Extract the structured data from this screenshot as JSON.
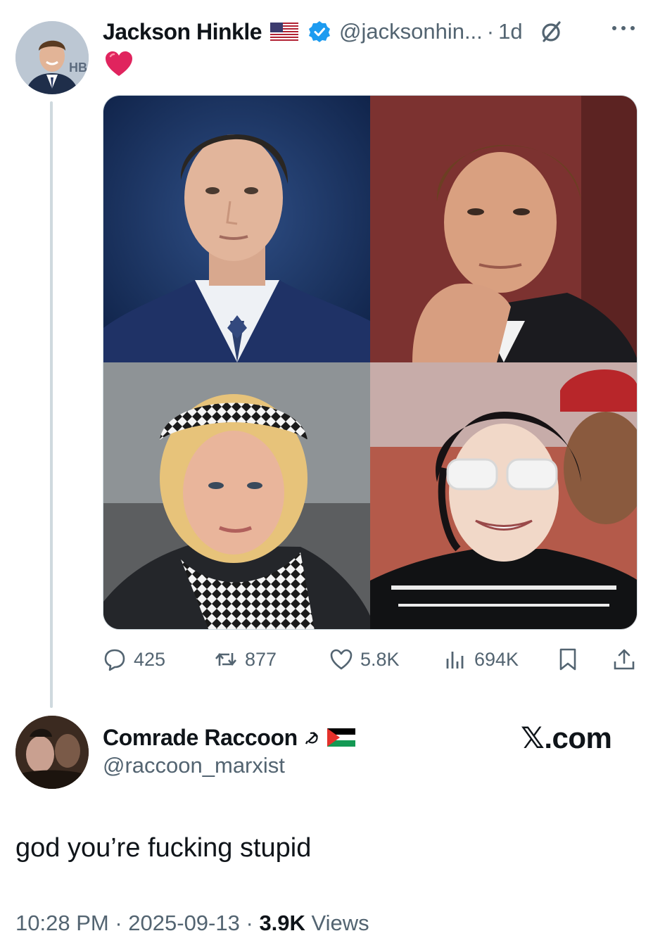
{
  "tweet": {
    "author_name": "Jackson Hinkle",
    "author_handle": "@jacksonhin...",
    "separator": "·",
    "time_ago": "1d",
    "body_emoji": "red-heart",
    "avatar_text": "HB",
    "icons": {
      "flag": "us-flag-icon",
      "verified": "verified-badge-icon",
      "grok": "grok-icon",
      "more": "more-icon"
    },
    "media_grid": [
      "photo-man-blue-suit",
      "photo-man-dark-suit",
      "photo-woman-keffiyeh-headband",
      "photo-man-sunglasses-uniform"
    ],
    "stats": {
      "replies": "425",
      "retweets": "877",
      "likes": "5.8K",
      "views": "694K"
    }
  },
  "reply": {
    "author_name": "Comrade Raccoon",
    "author_handle": "@raccoon_marxist",
    "name_icons": [
      "hammer-sickle-icon",
      "palestine-flag-icon"
    ],
    "watermark": "𝕏.com",
    "text": "god you’re fucking stupid",
    "timestamp": "10:28 PM",
    "date": "2025-09-13",
    "separator": "·",
    "views_count": "3.9K",
    "views_label": "Views"
  },
  "colors": {
    "text_primary": "#0f1419",
    "text_secondary": "#536471",
    "verified_blue": "#1d9bf0",
    "heart_red": "#e0245e",
    "divider": "#cfd9de"
  }
}
